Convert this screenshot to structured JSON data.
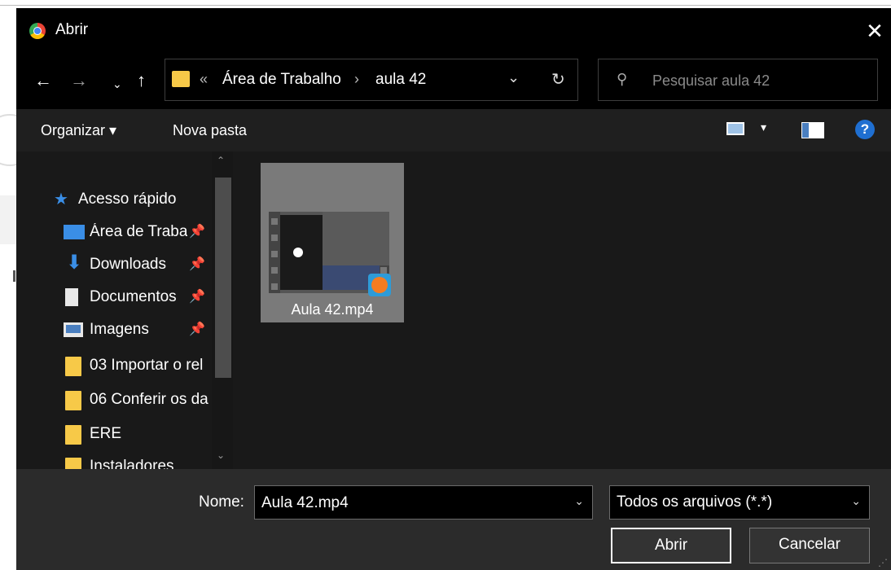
{
  "window": {
    "title": "Abrir",
    "close_glyph": "✕",
    "icon": "chrome-icon"
  },
  "nav": {
    "back_glyph": "←",
    "forward_glyph": "→",
    "recent_glyph": "⌄",
    "up_glyph": "↑",
    "breadcrumb_overflow": "«",
    "breadcrumb": [
      "Área de Trabalho",
      "aula 42"
    ],
    "breadcrumb_sep": "›",
    "dropdown_glyph": "⌄",
    "refresh_glyph": "↻",
    "search_placeholder": "Pesquisar aula 42",
    "search_glyph": "⚲"
  },
  "toolbar": {
    "organize_label": "Organizar ▾",
    "new_folder_label": "Nova pasta",
    "view_dropdown_glyph": "▾",
    "help_glyph": "?"
  },
  "sidebar": {
    "items": [
      {
        "label": "Acesso rápido",
        "icon": "star-icon",
        "pinned": false
      },
      {
        "label": "Área de Traba",
        "icon": "desktop-icon",
        "pinned": true
      },
      {
        "label": "Downloads",
        "icon": "download-icon",
        "pinned": true
      },
      {
        "label": "Documentos",
        "icon": "document-icon",
        "pinned": true
      },
      {
        "label": "Imagens",
        "icon": "pictures-icon",
        "pinned": true
      },
      {
        "label": "03 Importar o rel",
        "icon": "folder-icon",
        "pinned": false
      },
      {
        "label": "06 Conferir os da",
        "icon": "folder-icon",
        "pinned": false
      },
      {
        "label": "ERE",
        "icon": "folder-icon",
        "pinned": false
      },
      {
        "label": "Instaladores",
        "icon": "folder-icon",
        "pinned": false
      }
    ],
    "pin_glyph": "📌",
    "star_glyph": "★",
    "download_glyph": "⬇",
    "scroll_up_glyph": "⌃",
    "scroll_down_glyph": "⌄"
  },
  "files": [
    {
      "name": "Aula 42.mp4",
      "icon": "video-file-icon",
      "selected": true
    }
  ],
  "footer": {
    "name_label": "Nome:",
    "name_value": "Aula 42.mp4",
    "name_dropdown_glyph": "⌄",
    "filetype_value": "Todos os arquivos (*.*)",
    "filetype_dropdown_glyph": "⌄",
    "open_label": "Abrir",
    "cancel_label": "Cancelar",
    "grip_glyph": "⋰"
  },
  "colors": {
    "background": "#191919",
    "titlebar": "#000000",
    "accent": "#3a8ee6",
    "folder": "#f7c948",
    "selection": "#7a7a7a"
  }
}
